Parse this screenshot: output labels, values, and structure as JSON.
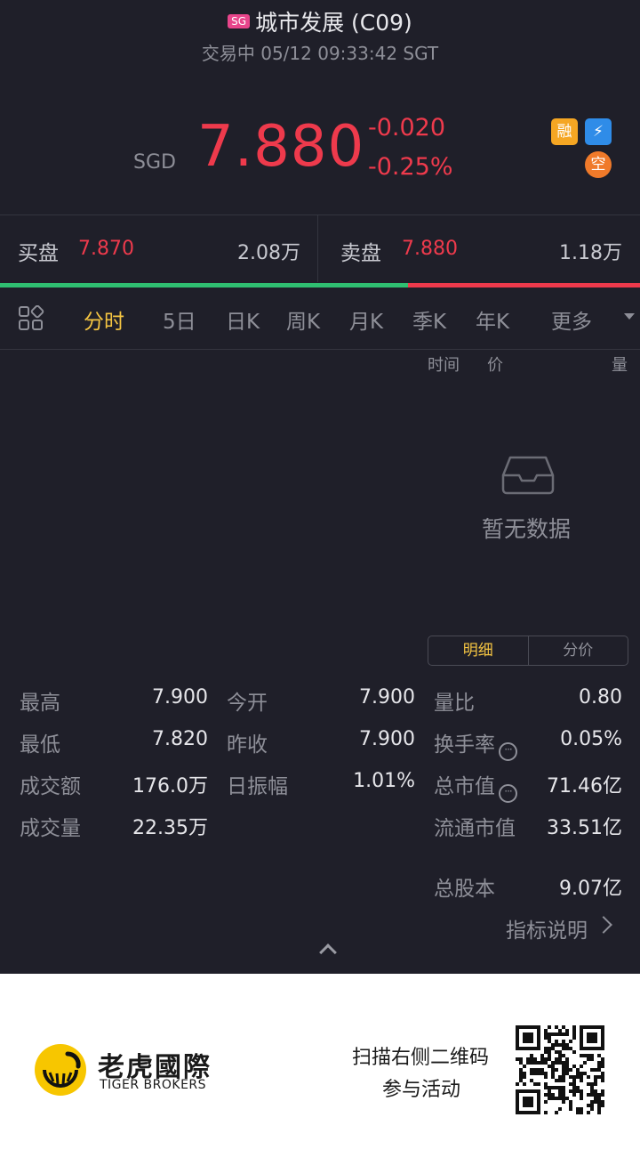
{
  "header": {
    "market_badge": "SG",
    "title": "城市发展 (C09)",
    "subtitle": "交易中 05/12 09:33:42 SGT"
  },
  "quote": {
    "currency": "SGD",
    "price": "7.880",
    "change": "-0.020",
    "change_pct": "-0.25%",
    "badges": [
      "融",
      "⚡",
      "空"
    ]
  },
  "orderbook": {
    "bid_label": "买盘",
    "bid_price": "7.870",
    "bid_volume": "2.08万",
    "ask_label": "卖盘",
    "ask_price": "7.880",
    "ask_volume": "1.18万",
    "bid_ratio": 0.6375
  },
  "tabs": [
    "分时",
    "5日",
    "日K",
    "周K",
    "月K",
    "季K",
    "年K",
    "更多"
  ],
  "active_tab": "分时",
  "columns": {
    "time": "时间",
    "price": "价",
    "volume": "量"
  },
  "empty_state": "暂无数据",
  "segment": {
    "detail": "明细",
    "price_dist": "分价"
  },
  "stats": {
    "high_label": "最高",
    "high": "7.900",
    "open_label": "今开",
    "open": "7.900",
    "vol_ratio_label": "量比",
    "vol_ratio": "0.80",
    "low_label": "最低",
    "low": "7.820",
    "prev_close_label": "昨收",
    "prev_close": "7.900",
    "turnover_rate_label": "换手率",
    "turnover_rate": "0.05%",
    "amount_label": "成交额",
    "amount": "176.0万",
    "amplitude_label": "日振幅",
    "amplitude": "1.01%",
    "mkt_cap_label": "总市值",
    "mkt_cap": "71.46亿",
    "volume_label": "成交量",
    "volume": "22.35万",
    "float_cap_label": "流通市值",
    "float_cap": "33.51亿",
    "total_shares_label": "总股本",
    "total_shares": "9.07亿"
  },
  "indicator_link": "指标说明",
  "footer": {
    "brand_cn": "老虎國際",
    "brand_en": "TIGER BROKERS",
    "promo_line1": "扫描右侧二维码",
    "promo_line2": "参与活动"
  },
  "colors": {
    "background": "#1f1f29",
    "down_red": "#ee3a4c",
    "up_green": "#2fbf71",
    "active_yellow": "#f5c542"
  }
}
